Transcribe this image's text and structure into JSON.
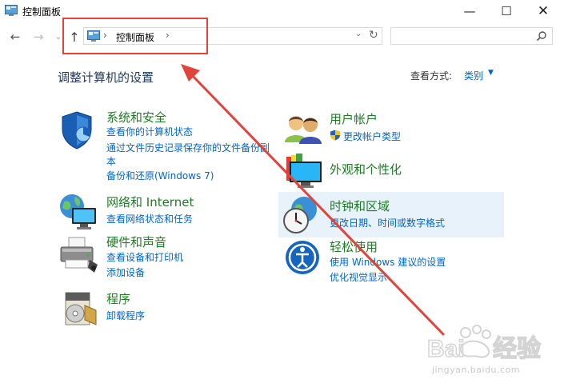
{
  "window": {
    "title": "控制面板",
    "minimize_glyph": "—",
    "maximize_glyph": "☐",
    "close_glyph": "✕"
  },
  "nav": {
    "back_glyph": "←",
    "forward_glyph": "→",
    "recent_glyph": "⌄",
    "up_glyph": "↑",
    "chevron": "›",
    "breadcrumb": "控制面板",
    "dropdown_glyph": "⌄",
    "refresh_glyph": "↻",
    "search_placeholder": ""
  },
  "header": {
    "title": "调整计算机的设置",
    "view_label": "查看方式:",
    "view_value": "类别",
    "view_caret": "▼"
  },
  "categories": {
    "system": {
      "icon": "shield-icon",
      "title": "系统和安全",
      "links": [
        "查看你的计算机状态",
        "通过文件历史记录保存你的文件备份副",
        "本",
        "备份和还原(Windows 7)"
      ]
    },
    "network": {
      "icon": "network-globe-icon",
      "title": "网络和 Internet",
      "links": [
        "查看网络状态和任务"
      ]
    },
    "hardware": {
      "icon": "printer-icon",
      "title": "硬件和声音",
      "links": [
        "查看设备和打印机",
        "添加设备"
      ]
    },
    "programs": {
      "icon": "programs-disc-icon",
      "title": "程序",
      "links": [
        "卸载程序"
      ]
    },
    "accounts": {
      "icon": "users-icon",
      "title": "用户帐户",
      "links": [
        "更改帐户类型"
      ]
    },
    "appearance": {
      "icon": "display-color-icon",
      "title": "外观和个性化",
      "links": []
    },
    "clock": {
      "icon": "clock-globe-icon",
      "title": "时钟和区域",
      "links": [
        "更改日期、时间或数字格式"
      ]
    },
    "ease": {
      "icon": "ease-of-access-icon",
      "title": "轻松使用",
      "links": [
        "使用 Windows 建议的设置",
        "优化视觉显示"
      ]
    }
  },
  "watermark": {
    "brand": "Baidu经验",
    "url": "jingyan.baidu.com"
  },
  "colors": {
    "category_title": "#1e7d22",
    "link": "#0066cc",
    "heading": "#1e395b",
    "annotation": "#e0443b",
    "highlight": "#e8f2fb"
  }
}
